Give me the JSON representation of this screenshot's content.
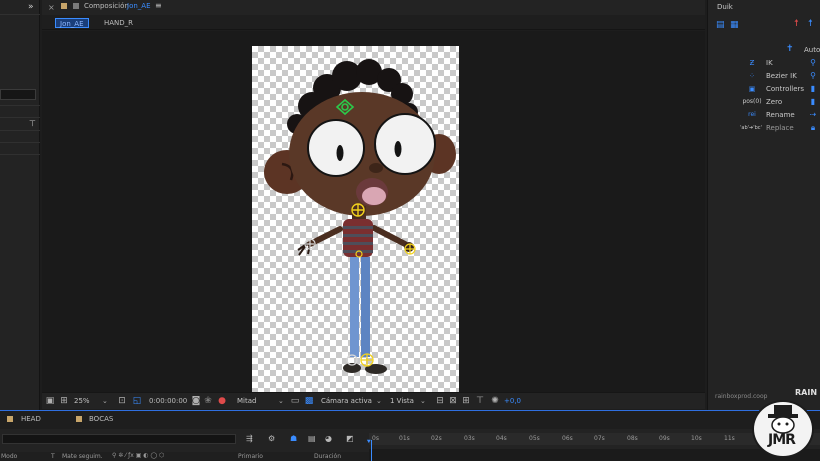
{
  "comp_header": {
    "title": "Composición",
    "comp_name": "Jon_AE",
    "menu": "≡",
    "collapse": "»",
    "close": "×"
  },
  "comp_tabs": [
    "Jon_AE",
    "HAND_R"
  ],
  "viewer_toolbar": {
    "zoom": "25%",
    "timecode": "0:00:00:00",
    "resolution": "Mitad",
    "camera": "Cámara activa",
    "views": "1 Vista",
    "exposure": "+0,0"
  },
  "duik": {
    "title": "Duik",
    "auto_label": "Auto-",
    "rows": [
      {
        "icon": "ik-icon",
        "label": "IK"
      },
      {
        "icon": "bezier-ik-icon",
        "label": "Bezier IK"
      },
      {
        "icon": "controllers-icon",
        "label": "Controllers"
      },
      {
        "icon": "zero-icon",
        "icon_text": "pos(0)",
        "label": "Zero"
      },
      {
        "icon": "rename-icon",
        "icon_text": "rei",
        "label": "Rename"
      },
      {
        "icon": "replace-icon",
        "icon_text": "'ab'➔'bc'",
        "label": "Replace"
      }
    ],
    "footer_text": "rainboxprod.coop"
  },
  "timeline": {
    "tabs": [
      "HEAD",
      "BOCAS"
    ],
    "ruler": [
      "0s",
      "01s",
      "02s",
      "03s",
      "04s",
      "05s",
      "06s",
      "07s",
      "08s",
      "09s",
      "10s",
      "11s"
    ],
    "columns": [
      "Modo",
      "T",
      "Mate seguim.",
      "Primario",
      "Duración"
    ]
  },
  "watermark": "JMR",
  "colors": {
    "accent": "#3a8cff",
    "panel": "#232323",
    "comp_label": "#d6a24a",
    "rig_yellow": "#f2d21c",
    "rig_green": "#2cc84a"
  }
}
